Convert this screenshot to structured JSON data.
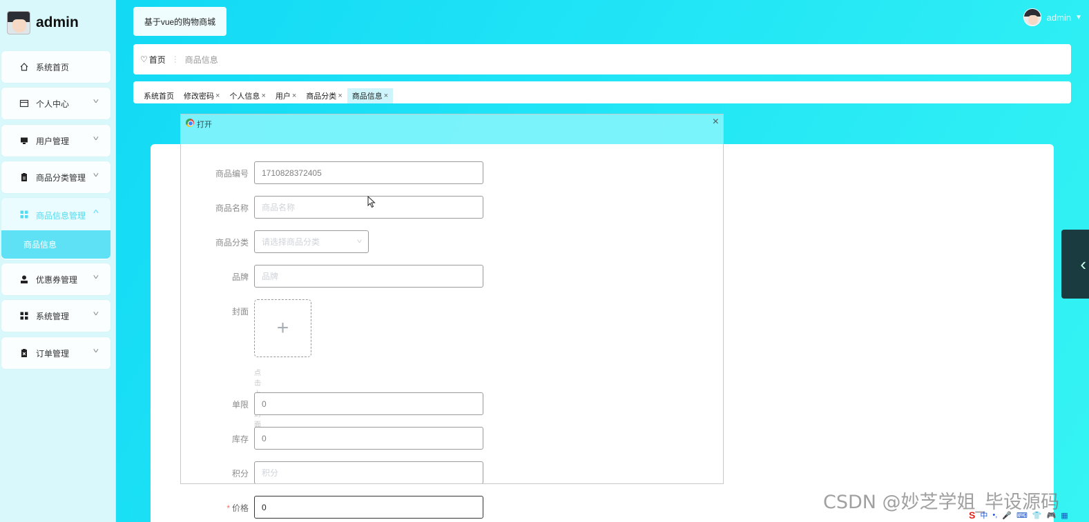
{
  "brand": {
    "name": "admin"
  },
  "sidebar": {
    "items": [
      {
        "label": "系统首页",
        "icon": "home-icon",
        "has_children": false
      },
      {
        "label": "个人中心",
        "icon": "card-icon",
        "has_children": true
      },
      {
        "label": "用户管理",
        "icon": "monitor-icon",
        "has_children": true
      },
      {
        "label": "商品分类管理",
        "icon": "clipboard-icon",
        "has_children": true
      },
      {
        "label": "商品信息管理",
        "icon": "grid-icon",
        "has_children": true,
        "expanded": true
      },
      {
        "label": "优惠券管理",
        "icon": "user-icon",
        "has_children": true
      },
      {
        "label": "系统管理",
        "icon": "grid-icon",
        "has_children": true
      },
      {
        "label": "订单管理",
        "icon": "clipboard-x-icon",
        "has_children": true
      }
    ],
    "submenu": {
      "label": "商品信息"
    }
  },
  "header": {
    "site_title": "基于vue的购物商城",
    "user_name": "admin"
  },
  "breadcrumb": {
    "home": "首页",
    "separator": "⋮",
    "current": "商品信息"
  },
  "tabs": [
    {
      "label": "系统首页",
      "closable": false
    },
    {
      "label": "修改密码",
      "closable": true
    },
    {
      "label": "个人信息",
      "closable": true
    },
    {
      "label": "用户",
      "closable": true
    },
    {
      "label": "商品分类",
      "closable": true
    },
    {
      "label": "商品信息",
      "closable": true,
      "active": true
    }
  ],
  "form": {
    "product_no": {
      "label": "商品编号",
      "value": "1710828372405"
    },
    "product_name": {
      "label": "商品名称",
      "placeholder": "商品名称"
    },
    "category": {
      "label": "商品分类",
      "placeholder": "请选择商品分类"
    },
    "brand": {
      "label": "品牌",
      "placeholder": "品牌"
    },
    "cover": {
      "label": "封面",
      "tip": "点击上传封面",
      "plus": "+"
    },
    "limit": {
      "label": "单限",
      "value": "0"
    },
    "stock": {
      "label": "库存",
      "value": "0"
    },
    "points": {
      "label": "积分",
      "placeholder": "积分"
    },
    "price": {
      "label": "价格",
      "value": "0",
      "required_mark": "*"
    }
  },
  "dialog": {
    "title": "打开",
    "close": "×"
  },
  "side_toggle": {
    "glyph": "‹"
  },
  "watermark": "CSDN @妙芝学姐_毕设源码",
  "ime": {
    "logo": "S",
    "lang": "中",
    "items": [
      "•,",
      "🎤",
      "⌨",
      "👕",
      "🎮",
      "▦"
    ]
  },
  "colors": {
    "accent": "#53dbf0",
    "bg_start": "#0fd6f4",
    "bg_end": "#36f4f3",
    "required": "#f56c6c"
  }
}
